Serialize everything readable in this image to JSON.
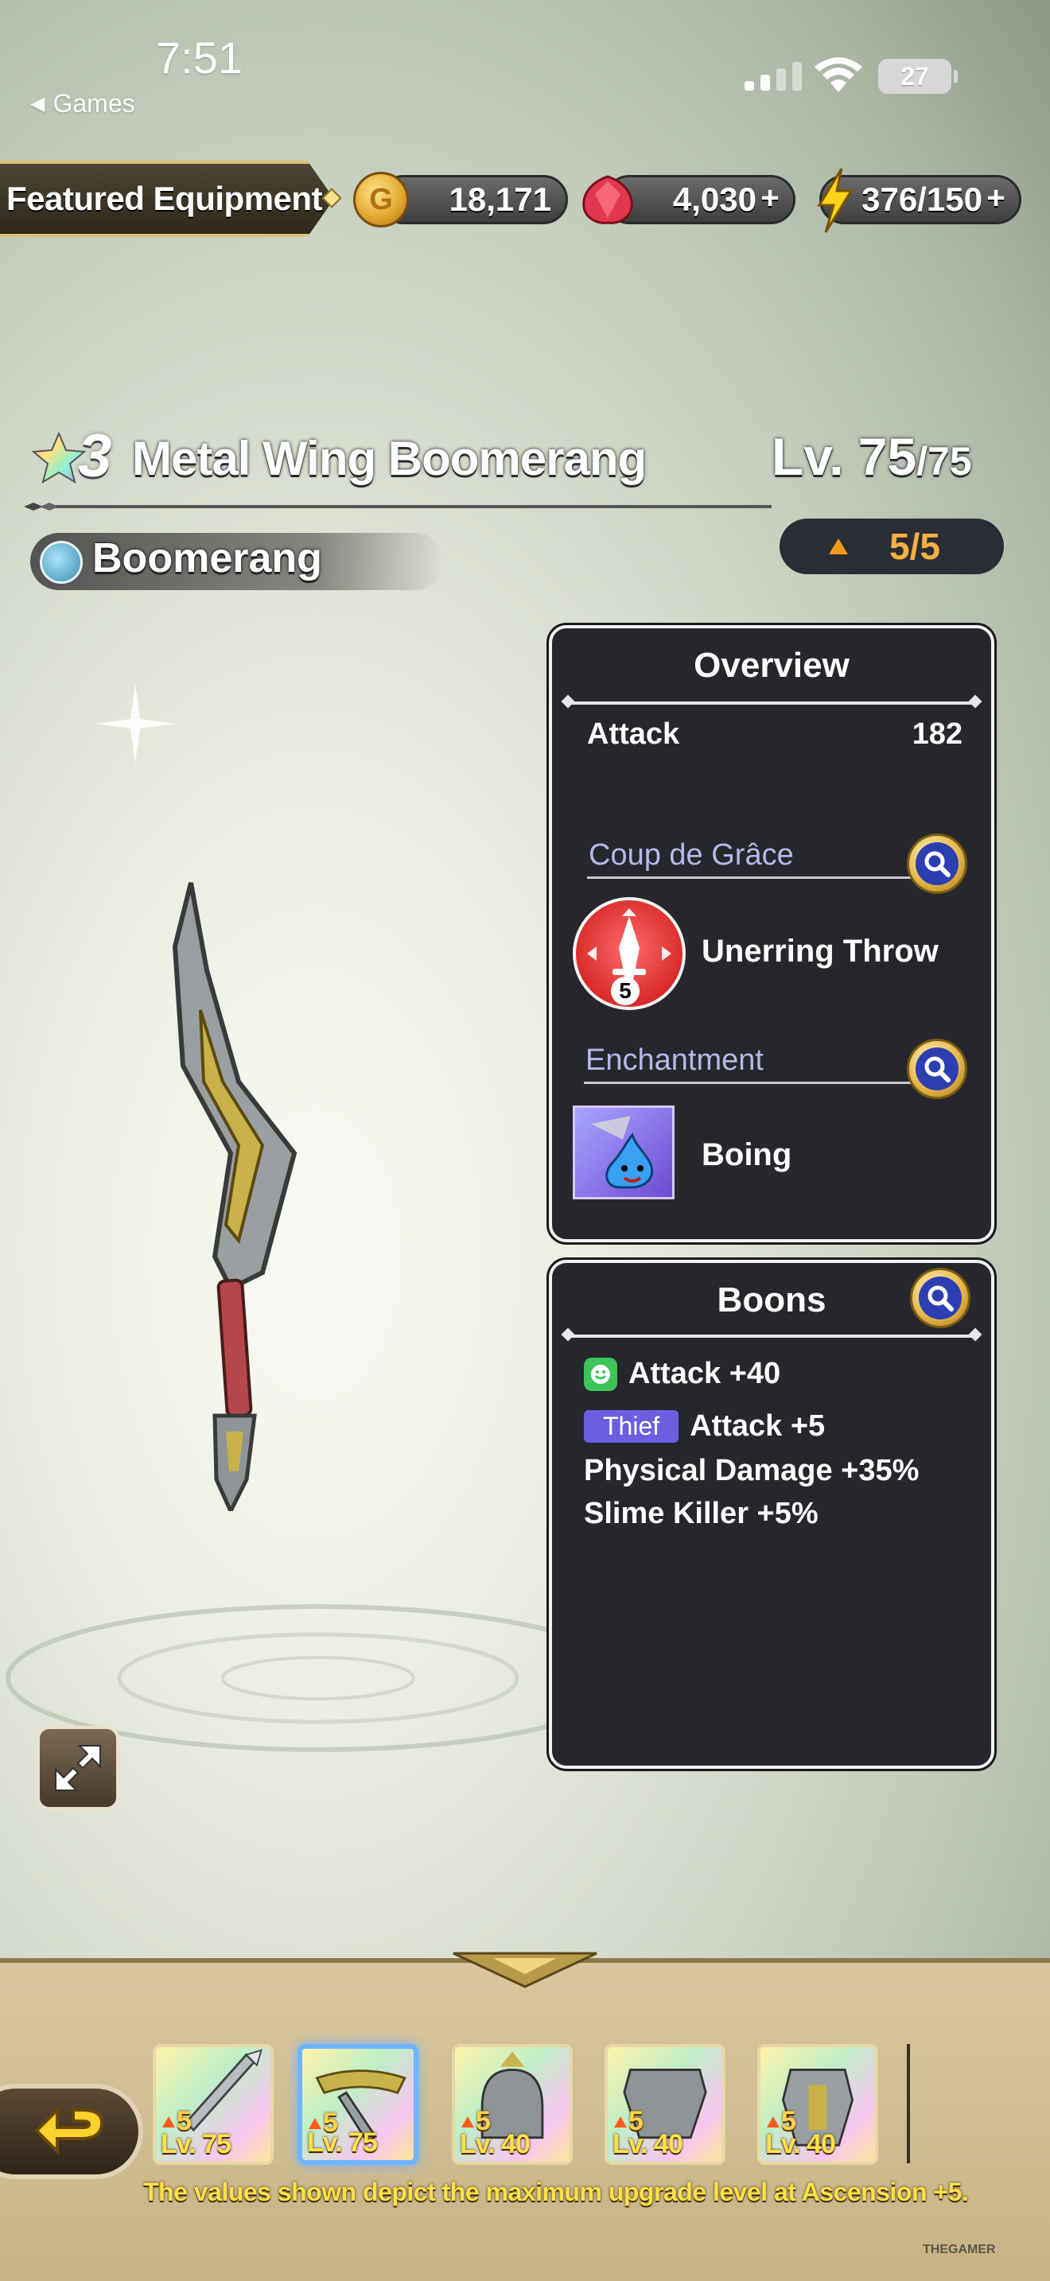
{
  "status": {
    "time": "7:51",
    "back_label": "Games",
    "battery": "27"
  },
  "header": {
    "title": "Featured Equipment",
    "gold": "18,171",
    "gems": "4,030",
    "stamina": "376/150",
    "coin_symbol": "G"
  },
  "item": {
    "rarity": "3",
    "name": "Metal Wing Boomerang",
    "level": "Lv. 75",
    "level_max": "/75",
    "type": "Boomerang",
    "ascension": "5/5"
  },
  "overview": {
    "title": "Overview",
    "attack_label": "Attack",
    "attack_value": "182",
    "coup_label": "Coup de Grâce",
    "coup_skill": "Unerring Throw",
    "coup_level": "5",
    "enchant_label": "Enchantment",
    "enchant_name": "Boing"
  },
  "boons": {
    "title": "Boons",
    "lines": [
      {
        "tag": "",
        "text": "Attack +40"
      },
      {
        "tag": "Thief",
        "text": "Attack +5"
      },
      {
        "tag": "",
        "text": "Physical Damage +35%"
      },
      {
        "tag": "",
        "text": "Slime Killer +5%"
      }
    ]
  },
  "equipment_bar": {
    "slots": [
      {
        "asc": "5",
        "level": "Lv. 75"
      },
      {
        "asc": "5",
        "level": "Lv. 75"
      },
      {
        "asc": "5",
        "level": "Lv. 40"
      },
      {
        "asc": "5",
        "level": "Lv. 40"
      },
      {
        "asc": "5",
        "level": "Lv. 40"
      }
    ],
    "footnote": "The values shown depict the maximum upgrade level at Ascension +5."
  },
  "watermark": "THEGAMER",
  "colors": {
    "accent_gold": "#d9c17a",
    "panel_bg": "#25272d",
    "section_label": "#b9b7e8",
    "footnote": "#ffe04a"
  }
}
